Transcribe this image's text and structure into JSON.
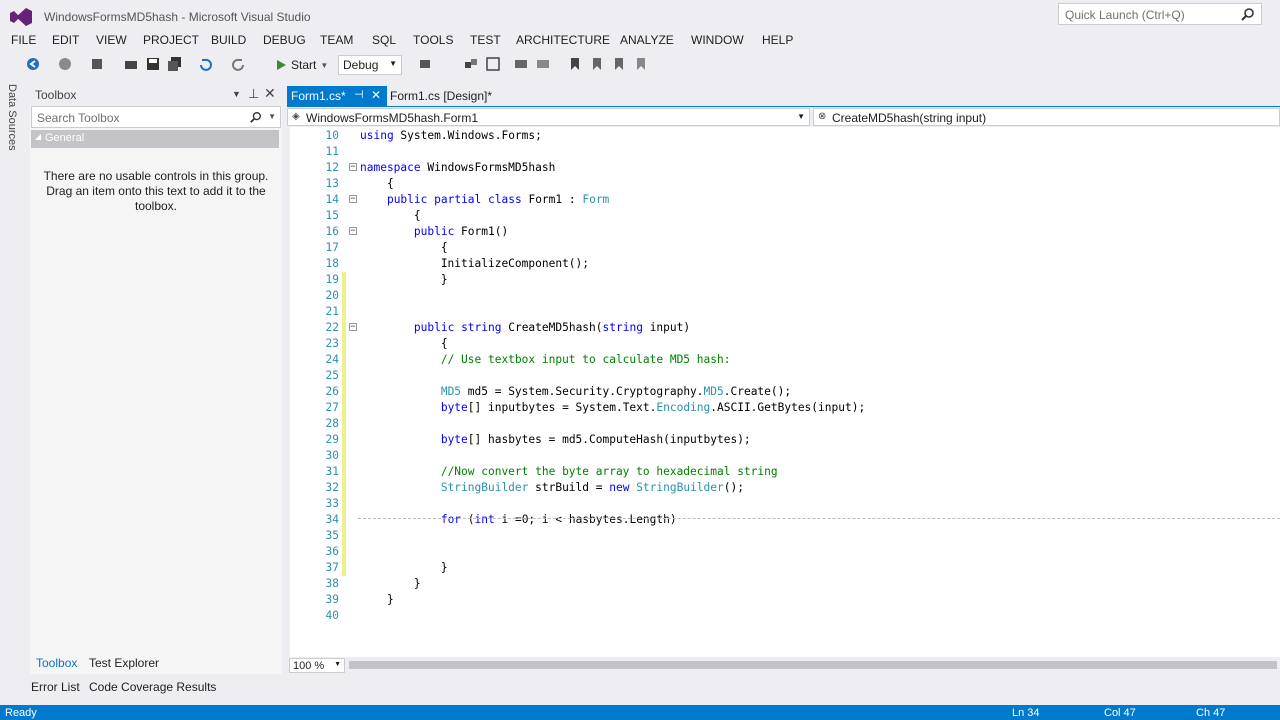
{
  "window": {
    "title": "WindowsFormsMD5hash - Microsoft Visual Studio",
    "quick_launch_placeholder": "Quick Launch (Ctrl+Q)"
  },
  "menu": [
    "FILE",
    "EDIT",
    "VIEW",
    "PROJECT",
    "BUILD",
    "DEBUG",
    "TEAM",
    "SQL",
    "TOOLS",
    "TEST",
    "ARCHITECTURE",
    "ANALYZE",
    "WINDOW",
    "HELP"
  ],
  "toolbar": {
    "start_label": "Start",
    "configuration": "Debug"
  },
  "side_tab": {
    "label": "Data Sources"
  },
  "toolbox": {
    "title": "Toolbox",
    "search_placeholder": "Search Toolbox",
    "group": "General",
    "empty_message": "There are no usable controls in this group. Drag an item onto this text to add it to the toolbox.",
    "tabs": [
      "Toolbox",
      "Test Explorer"
    ]
  },
  "editor": {
    "tabs": [
      "Form1.cs*",
      "Form1.cs [Design]*"
    ],
    "nav_left": "WindowsFormsMD5hash.Form1",
    "nav_right": "CreateMD5hash(string input)",
    "zoom": "100 %",
    "lines": [
      {
        "n": "10",
        "text": "using System.Windows.Forms;"
      },
      {
        "n": "11",
        "text": ""
      },
      {
        "n": "12",
        "text": "namespace WindowsFormsMD5hash"
      },
      {
        "n": "13",
        "text": "    {"
      },
      {
        "n": "14",
        "text": "    public partial class Form1 : Form"
      },
      {
        "n": "15",
        "text": "        {"
      },
      {
        "n": "16",
        "text": "        public Form1()"
      },
      {
        "n": "17",
        "text": "            {"
      },
      {
        "n": "18",
        "text": "            InitializeComponent();"
      },
      {
        "n": "19",
        "text": "            }"
      },
      {
        "n": "20",
        "text": ""
      },
      {
        "n": "21",
        "text": ""
      },
      {
        "n": "22",
        "text": "        public string CreateMD5hash(string input)"
      },
      {
        "n": "23",
        "text": "            {"
      },
      {
        "n": "24",
        "text": "            // Use textbox input to calculate MD5 hash:"
      },
      {
        "n": "25",
        "text": ""
      },
      {
        "n": "26",
        "text": "            MD5 md5 = System.Security.Cryptography.MD5.Create();"
      },
      {
        "n": "27",
        "text": "            byte[] inputbytes = System.Text.Encoding.ASCII.GetBytes(input);"
      },
      {
        "n": "28",
        "text": ""
      },
      {
        "n": "29",
        "text": "            byte[] hasbytes = md5.ComputeHash(inputbytes);"
      },
      {
        "n": "30",
        "text": ""
      },
      {
        "n": "31",
        "text": "            //Now convert the byte array to hexadecimal string"
      },
      {
        "n": "32",
        "text": "            StringBuilder strBuild = new StringBuilder();"
      },
      {
        "n": "33",
        "text": ""
      },
      {
        "n": "34",
        "text": "            for (int i =0; i < hasbytes.Length)"
      },
      {
        "n": "35",
        "text": ""
      },
      {
        "n": "36",
        "text": ""
      },
      {
        "n": "37",
        "text": "            }"
      },
      {
        "n": "38",
        "text": "        }"
      },
      {
        "n": "39",
        "text": "    }"
      },
      {
        "n": "40",
        "text": ""
      }
    ]
  },
  "bottom_tabs": [
    "Error List",
    "Code Coverage Results"
  ],
  "status": {
    "text": "Ready",
    "line": "Ln 34",
    "col": "Col 47",
    "ch": "Ch 47"
  },
  "colors": {
    "accent": "#007acc",
    "keyword": "#0000ff",
    "type": "#2b91af",
    "comment": "#008000"
  }
}
